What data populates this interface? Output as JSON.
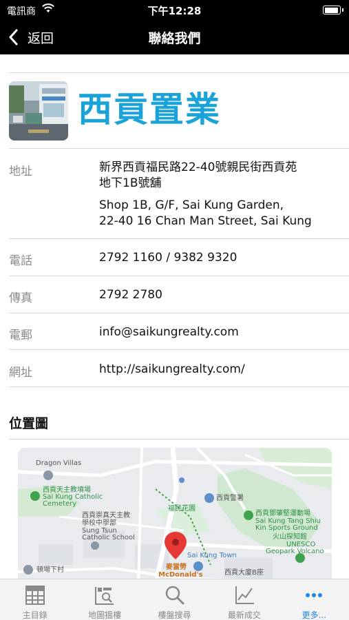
{
  "status_bar": {
    "carrier": "電訊商",
    "time": "下午12:28",
    "battery_level": 0.95
  },
  "nav": {
    "back_label": "返回",
    "title": "聯絡我們"
  },
  "company": {
    "name": "西貢置業"
  },
  "contact": {
    "address": {
      "label": "地址",
      "zh_line1": "新界西貢福民路22-40號親民街西貢苑",
      "zh_line2": "地下1B號舖",
      "en_line1": "Shop 1B, G/F, Sai Kung Garden,",
      "en_line2": "22-40 16 Chan Man Street, Sai Kung"
    },
    "phone": {
      "label": "電話",
      "value": "2792 1160 / 9382 9320"
    },
    "fax": {
      "label": "傳真",
      "value": "2792 2780"
    },
    "email": {
      "label": "電郵",
      "value": "info@saikungrealty.com"
    },
    "website": {
      "label": "網址",
      "value": "http://saikungrealty.com/"
    }
  },
  "map_section": {
    "title": "位置圖",
    "labels": {
      "dragon_villas": "Dragon Villas",
      "cemetery_zh": "西貢天主教墳場",
      "cemetery_en1": "Sai Kung Catholic",
      "cemetery_en2": "Cemetery",
      "school_zh1": "西貢崇真天主教",
      "school_zh2": "學校中學部",
      "school_en1": "Sung Tsun",
      "school_en2": "Catholic School",
      "fuk_man_garden": "福民花園",
      "saikung_police": "西貢警署",
      "sports_ground_zh": "西貢鄧肇堅運動場",
      "sports_ground_en1": "Sai Kung Tang Shiu",
      "sports_ground_en2": "Kin Sports Ground",
      "volcano_zh": "火山探知館",
      "volcano_en1": "UNESCO",
      "volcano_en2": "Geopark Volcano",
      "sai_kung_town": "Sai Kung Town",
      "mcdonalds_zh": "麥當勞",
      "mcdonalds_en": "McDonald's",
      "village": "頓場下村",
      "building": "西貢大廈B座"
    }
  },
  "tabs": [
    {
      "label": "主目錄",
      "icon": "grid-icon"
    },
    {
      "label": "地圖搵樓",
      "icon": "map-search-icon"
    },
    {
      "label": "樓盤搜尋",
      "icon": "magnifier-icon"
    },
    {
      "label": "最新成交",
      "icon": "line-chart-icon"
    },
    {
      "label": "更多...",
      "icon": "more-icon"
    }
  ],
  "colors": {
    "brand": "#1aa3d8",
    "tab_active": "#1e88e5",
    "nav_background": "#000000"
  }
}
